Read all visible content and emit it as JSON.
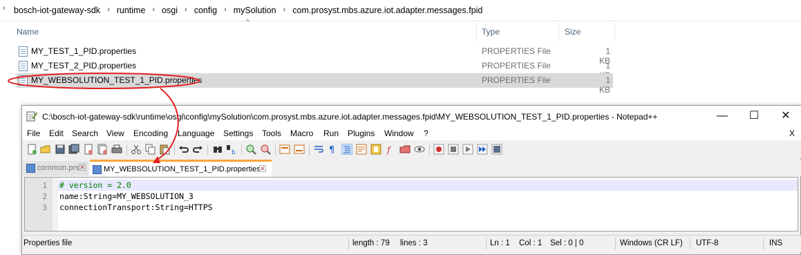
{
  "explorer": {
    "breadcrumb": [
      "bosch-iot-gateway-sdk",
      "runtime",
      "osgi",
      "config",
      "mySolution",
      "com.prosyst.mbs.azure.iot.adapter.messages.fpid"
    ],
    "columns": {
      "name": "Name",
      "type": "Type",
      "size": "Size"
    },
    "files": [
      {
        "name": "MY_TEST_1_PID.properties",
        "type": "PROPERTIES File",
        "size": "1 KB"
      },
      {
        "name": "MY_TEST_2_PID.properties",
        "type": "PROPERTIES File",
        "size": "1 KB"
      },
      {
        "name": "MY_WEBSOLUTION_TEST_1_PID.properties",
        "type": "PROPERTIES File",
        "size": "1 KB",
        "selected": true
      }
    ]
  },
  "notepad": {
    "title": "C:\\bosch-iot-gateway-sdk\\runtime\\osgi\\config\\mySolution\\com.prosyst.mbs.azure.iot.adapter.messages.fpid\\MY_WEBSOLUTION_TEST_1_PID.properties - Notepad++",
    "window_buttons": {
      "minimize": "—",
      "maximize": "☐",
      "close": "✕"
    },
    "menu": [
      "File",
      "Edit",
      "Search",
      "View",
      "Encoding",
      "Language",
      "Settings",
      "Tools",
      "Macro",
      "Run",
      "Plugins",
      "Window",
      "?"
    ],
    "menu_close": "X",
    "tabs": [
      {
        "label": "common.prs",
        "active": false
      },
      {
        "label": "MY_WEBSOLUTION_TEST_1_PID.properties",
        "active": true
      }
    ],
    "tab_close_glyph": "✕",
    "lines": [
      {
        "num": "1",
        "text": "# version = 2.0"
      },
      {
        "num": "2",
        "text": "name:String=MY_WEBSOLUTION_3"
      },
      {
        "num": "3",
        "text": "connectionTransport:String=HTTPS"
      }
    ],
    "status": {
      "file_type": "Properties file",
      "length": "length : 79",
      "lines": "lines : 3",
      "ln": "Ln : 1",
      "col": "Col : 1",
      "sel": "Sel : 0 | 0",
      "eol": "Windows (CR LF)",
      "encoding": "UTF-8",
      "mode": "INS"
    }
  },
  "colors": {
    "annotation": "#e02020",
    "tab_accent": "#f9a53a",
    "selection": "#d9d9d9",
    "current_line": "#e8e8ff",
    "comment": "#008000"
  }
}
